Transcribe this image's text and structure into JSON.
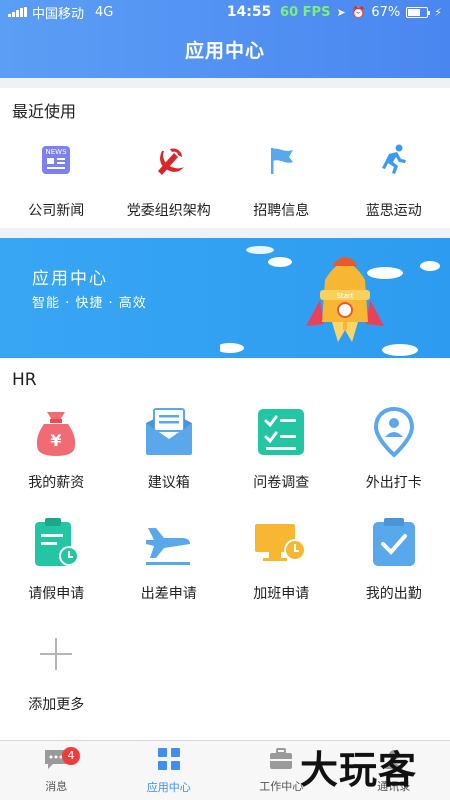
{
  "status_bar": {
    "carrier": "中国移动",
    "network": "4G",
    "time": "14:55",
    "fps": "60 FPS",
    "battery": "67%"
  },
  "header": {
    "title": "应用中心"
  },
  "recent": {
    "title": "最近使用",
    "items": [
      {
        "label": "公司新闻",
        "icon": "news-icon"
      },
      {
        "label": "党委组织架构",
        "icon": "party-emblem-icon"
      },
      {
        "label": "招聘信息",
        "icon": "flag-icon"
      },
      {
        "label": "蓝思运动",
        "icon": "running-man-icon"
      }
    ]
  },
  "banner": {
    "title": "应用中心",
    "subtitle": "智能 · 快捷 · 高效",
    "rocket_text": "Start",
    "colors": {
      "background": "#2d9cf0"
    }
  },
  "hr": {
    "title": "HR",
    "items": [
      {
        "label": "我的薪资",
        "icon": "money-bag-icon"
      },
      {
        "label": "建议箱",
        "icon": "mail-icon"
      },
      {
        "label": "问卷调查",
        "icon": "checklist-icon"
      },
      {
        "label": "外出打卡",
        "icon": "location-pin-icon"
      },
      {
        "label": "请假申请",
        "icon": "leave-clipboard-icon"
      },
      {
        "label": "出差申请",
        "icon": "airplane-icon"
      },
      {
        "label": "加班申请",
        "icon": "overtime-monitor-icon"
      },
      {
        "label": "我的出勤",
        "icon": "attendance-check-icon"
      },
      {
        "label": "添加更多",
        "icon": "plus-icon"
      }
    ]
  },
  "tabbar": {
    "tabs": [
      {
        "label": "消息",
        "badge": "4",
        "icon": "message-icon",
        "active": false
      },
      {
        "label": "应用中心",
        "icon": "apps-grid-icon",
        "active": true
      },
      {
        "label": "工作中心",
        "icon": "briefcase-icon",
        "active": false
      },
      {
        "label": "通讯录",
        "icon": "contacts-icon",
        "active": false
      }
    ],
    "accent": "#3f8ef0"
  },
  "watermark": "大玩客"
}
